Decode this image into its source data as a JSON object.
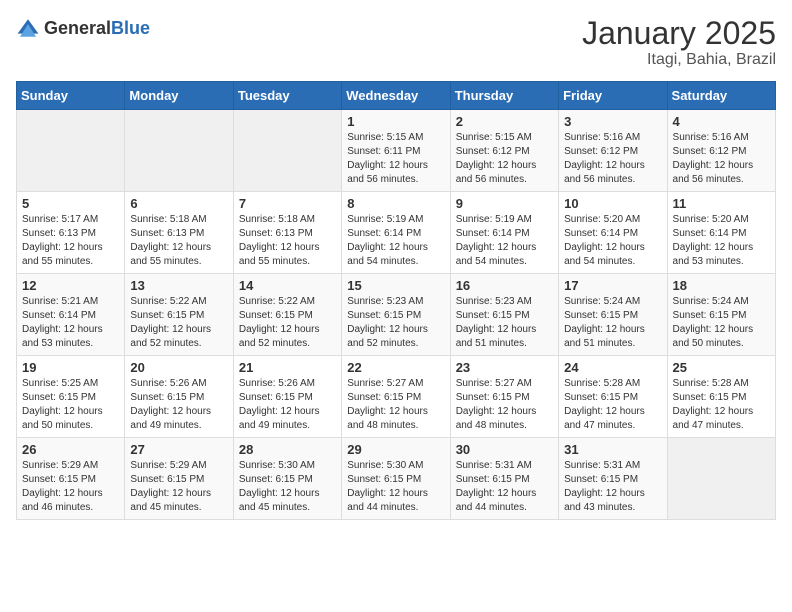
{
  "logo": {
    "general": "General",
    "blue": "Blue"
  },
  "title": "January 2025",
  "subtitle": "Itagi, Bahia, Brazil",
  "days_header": [
    "Sunday",
    "Monday",
    "Tuesday",
    "Wednesday",
    "Thursday",
    "Friday",
    "Saturday"
  ],
  "weeks": [
    [
      {
        "day": "",
        "info": ""
      },
      {
        "day": "",
        "info": ""
      },
      {
        "day": "",
        "info": ""
      },
      {
        "day": "1",
        "info": "Sunrise: 5:15 AM\nSunset: 6:11 PM\nDaylight: 12 hours\nand 56 minutes."
      },
      {
        "day": "2",
        "info": "Sunrise: 5:15 AM\nSunset: 6:12 PM\nDaylight: 12 hours\nand 56 minutes."
      },
      {
        "day": "3",
        "info": "Sunrise: 5:16 AM\nSunset: 6:12 PM\nDaylight: 12 hours\nand 56 minutes."
      },
      {
        "day": "4",
        "info": "Sunrise: 5:16 AM\nSunset: 6:12 PM\nDaylight: 12 hours\nand 56 minutes."
      }
    ],
    [
      {
        "day": "5",
        "info": "Sunrise: 5:17 AM\nSunset: 6:13 PM\nDaylight: 12 hours\nand 55 minutes."
      },
      {
        "day": "6",
        "info": "Sunrise: 5:18 AM\nSunset: 6:13 PM\nDaylight: 12 hours\nand 55 minutes."
      },
      {
        "day": "7",
        "info": "Sunrise: 5:18 AM\nSunset: 6:13 PM\nDaylight: 12 hours\nand 55 minutes."
      },
      {
        "day": "8",
        "info": "Sunrise: 5:19 AM\nSunset: 6:14 PM\nDaylight: 12 hours\nand 54 minutes."
      },
      {
        "day": "9",
        "info": "Sunrise: 5:19 AM\nSunset: 6:14 PM\nDaylight: 12 hours\nand 54 minutes."
      },
      {
        "day": "10",
        "info": "Sunrise: 5:20 AM\nSunset: 6:14 PM\nDaylight: 12 hours\nand 54 minutes."
      },
      {
        "day": "11",
        "info": "Sunrise: 5:20 AM\nSunset: 6:14 PM\nDaylight: 12 hours\nand 53 minutes."
      }
    ],
    [
      {
        "day": "12",
        "info": "Sunrise: 5:21 AM\nSunset: 6:14 PM\nDaylight: 12 hours\nand 53 minutes."
      },
      {
        "day": "13",
        "info": "Sunrise: 5:22 AM\nSunset: 6:15 PM\nDaylight: 12 hours\nand 52 minutes."
      },
      {
        "day": "14",
        "info": "Sunrise: 5:22 AM\nSunset: 6:15 PM\nDaylight: 12 hours\nand 52 minutes."
      },
      {
        "day": "15",
        "info": "Sunrise: 5:23 AM\nSunset: 6:15 PM\nDaylight: 12 hours\nand 52 minutes."
      },
      {
        "day": "16",
        "info": "Sunrise: 5:23 AM\nSunset: 6:15 PM\nDaylight: 12 hours\nand 51 minutes."
      },
      {
        "day": "17",
        "info": "Sunrise: 5:24 AM\nSunset: 6:15 PM\nDaylight: 12 hours\nand 51 minutes."
      },
      {
        "day": "18",
        "info": "Sunrise: 5:24 AM\nSunset: 6:15 PM\nDaylight: 12 hours\nand 50 minutes."
      }
    ],
    [
      {
        "day": "19",
        "info": "Sunrise: 5:25 AM\nSunset: 6:15 PM\nDaylight: 12 hours\nand 50 minutes."
      },
      {
        "day": "20",
        "info": "Sunrise: 5:26 AM\nSunset: 6:15 PM\nDaylight: 12 hours\nand 49 minutes."
      },
      {
        "day": "21",
        "info": "Sunrise: 5:26 AM\nSunset: 6:15 PM\nDaylight: 12 hours\nand 49 minutes."
      },
      {
        "day": "22",
        "info": "Sunrise: 5:27 AM\nSunset: 6:15 PM\nDaylight: 12 hours\nand 48 minutes."
      },
      {
        "day": "23",
        "info": "Sunrise: 5:27 AM\nSunset: 6:15 PM\nDaylight: 12 hours\nand 48 minutes."
      },
      {
        "day": "24",
        "info": "Sunrise: 5:28 AM\nSunset: 6:15 PM\nDaylight: 12 hours\nand 47 minutes."
      },
      {
        "day": "25",
        "info": "Sunrise: 5:28 AM\nSunset: 6:15 PM\nDaylight: 12 hours\nand 47 minutes."
      }
    ],
    [
      {
        "day": "26",
        "info": "Sunrise: 5:29 AM\nSunset: 6:15 PM\nDaylight: 12 hours\nand 46 minutes."
      },
      {
        "day": "27",
        "info": "Sunrise: 5:29 AM\nSunset: 6:15 PM\nDaylight: 12 hours\nand 45 minutes."
      },
      {
        "day": "28",
        "info": "Sunrise: 5:30 AM\nSunset: 6:15 PM\nDaylight: 12 hours\nand 45 minutes."
      },
      {
        "day": "29",
        "info": "Sunrise: 5:30 AM\nSunset: 6:15 PM\nDaylight: 12 hours\nand 44 minutes."
      },
      {
        "day": "30",
        "info": "Sunrise: 5:31 AM\nSunset: 6:15 PM\nDaylight: 12 hours\nand 44 minutes."
      },
      {
        "day": "31",
        "info": "Sunrise: 5:31 AM\nSunset: 6:15 PM\nDaylight: 12 hours\nand 43 minutes."
      },
      {
        "day": "",
        "info": ""
      }
    ]
  ]
}
